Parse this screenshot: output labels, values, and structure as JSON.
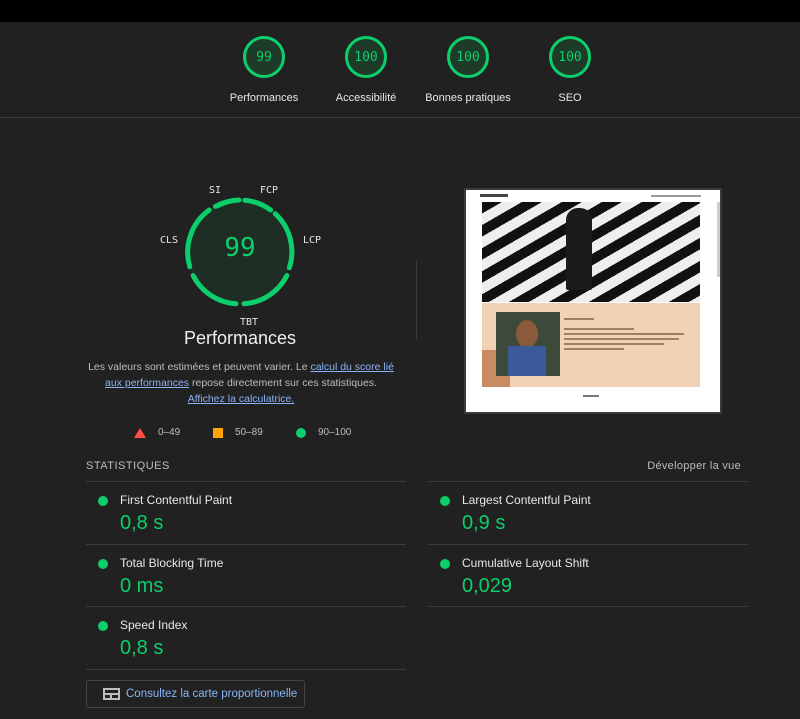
{
  "gauges": [
    {
      "score": "99",
      "label": "Performances"
    },
    {
      "score": "100",
      "label": "Accessibilité"
    },
    {
      "score": "100",
      "label": "Bonnes pratiques"
    },
    {
      "score": "100",
      "label": "SEO"
    }
  ],
  "main_gauge": {
    "score": "99",
    "title": "Performances",
    "metric_labels": {
      "si": "SI",
      "fcp": "FCP",
      "lcp": "LCP",
      "cls": "CLS",
      "tbt": "TBT"
    }
  },
  "description": {
    "text_1": "Les valeurs sont estimées et peuvent varier. Le ",
    "link_1": "calcul du score lié aux performances",
    "text_2": " repose directement sur ces statistiques. ",
    "link_2": "Affichez la calculatrice."
  },
  "legend": {
    "fail": "0–49",
    "average": "50–89",
    "pass": "90–100"
  },
  "stats": {
    "heading": "STATISTIQUES",
    "expand_label": "Développer la vue",
    "metrics": [
      {
        "name": "First Contentful Paint",
        "value": "0,8 s"
      },
      {
        "name": "Largest Contentful Paint",
        "value": "0,9 s"
      },
      {
        "name": "Total Blocking Time",
        "value": "0 ms"
      },
      {
        "name": "Cumulative Layout Shift",
        "value": "0,029"
      },
      {
        "name": "Speed Index",
        "value": "0,8 s"
      }
    ]
  },
  "treemap_button": "Consultez la carte proportionnelle",
  "colors": {
    "pass": "#0cce6b",
    "average": "#ffa400",
    "fail": "#ff4e42",
    "link": "#8ab4f8",
    "background": "#212121"
  },
  "icons": [
    "warning-triangle-icon",
    "average-square-icon",
    "pass-circle-icon",
    "treemap-icon"
  ]
}
